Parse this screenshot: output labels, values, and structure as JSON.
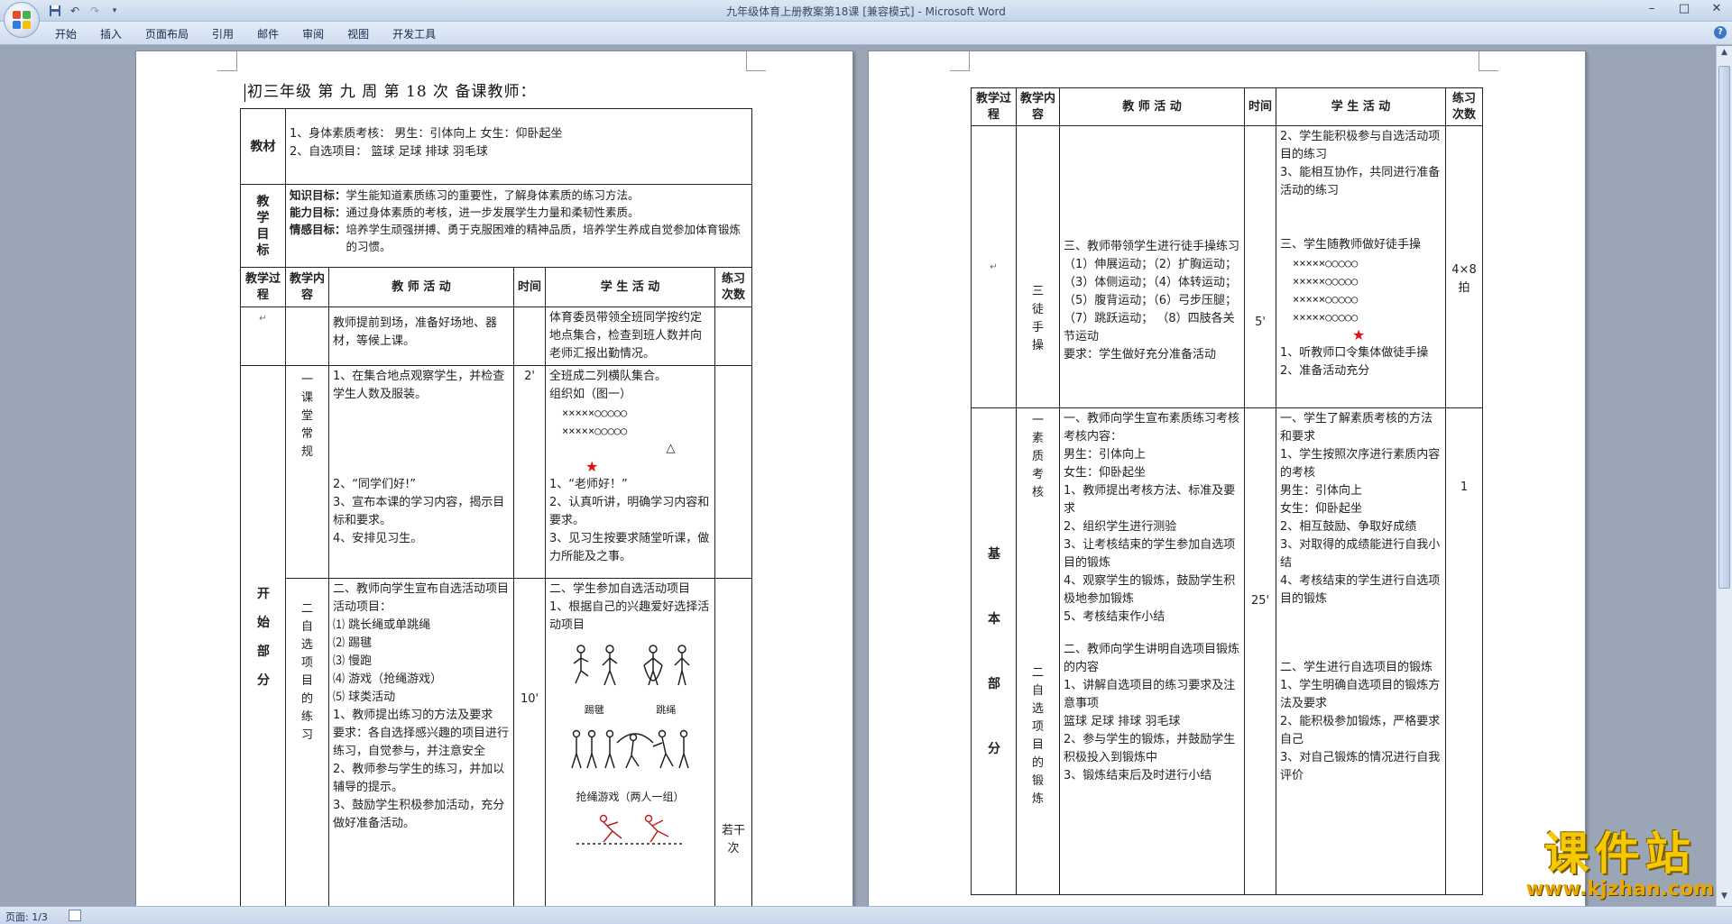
{
  "window": {
    "title": "九年级体育上册教案第18课 [兼容模式] - Microsoft Word"
  },
  "ribbon": {
    "tabs": [
      "开始",
      "插入",
      "页面布局",
      "引用",
      "邮件",
      "审阅",
      "视图",
      "开发工具"
    ]
  },
  "qat": {
    "undo": "↶",
    "redo": "↷"
  },
  "statusbar": {
    "page": "页面: 1/3"
  },
  "watermark": {
    "title": "课件站",
    "url": "www.kjzhan.com"
  },
  "page1": {
    "heading": "初三年级    第 九 周    第 18 次    备课教师：",
    "jiaocai_label": "教材",
    "jiaocai_l1": "1、身体素质考核：            男生：引体向上        女生：仰卧起坐",
    "jiaocai_l2": "2、自选项目：        篮球    足球    排球    羽毛球",
    "mubiao_label": "教学目标",
    "zhishi_label": "知识目标：",
    "zhishi": "学生能知道素质练习的重要性，了解身体素质的练习方法。",
    "nengli_label": "能力目标：",
    "nengli": "通过身体素质的考核，进一步发展学生力量和柔韧性素质。",
    "qinggan_label": "情感目标：",
    "qinggan": "培养学生顽强拼搏、勇于克服困难的精神品质，培养学生养成自觉参加体育锻炼的习惯。",
    "headers": [
      "教学过程",
      "教学内容",
      "教  师  活  动",
      "时间",
      "学  生  活  动",
      "练习次数"
    ],
    "r1_teacher": "教师提前到场，准备好场地、器材，等候上课。",
    "r1_student": "体育委员带领全班同学按约定地点集合，检查到班人数并向老师汇报出勤情况。",
    "part_label": "开始部分",
    "r2_content": "一课堂常规",
    "r2_teacher_1": "1、在集合地点观察学生，并检查学生人数及服装。",
    "r2_teacher_2": "2、“同学们好!”",
    "r2_teacher_3": "3、宣布本课的学习内容，揭示目标和要求。",
    "r2_teacher_4": "4、安排见习生。",
    "r2_time": "2'",
    "r2_student_1": "全班成二列横队集合。",
    "r2_student_2": "组织如（图一）",
    "formation_row": "×××××○○○○○",
    "triangle": "△",
    "star": "★",
    "r2_student_3": "1、“老师好！”",
    "r2_student_4": "2、认真听讲，明确学习内容和要求。",
    "r2_student_5": "3、见习生按要求随堂听课，做力所能及之事。",
    "r3_content": "二自选项目的练习",
    "r3_teacher_1": "二、教师向学生宣布自选活动项目",
    "r3_teacher_2": "活动项目：",
    "r3_teacher_3": "⑴ 跳长绳或单跳绳",
    "r3_teacher_4": "⑵ 踢毽",
    "r3_teacher_5": "⑶ 慢跑",
    "r3_teacher_6": "⑷ 游戏（抢绳游戏）",
    "r3_teacher_7": "⑸ 球类活动",
    "r3_teacher_8": "1、教师提出练习的方法及要求",
    "r3_teacher_9": "要求：各自选择感兴趣的项目进行练习，自觉参与，并注意安全",
    "r3_teacher_10": "2、教师参与学生的练习，并加以辅导的提示。",
    "r3_teacher_11": "3、鼓励学生积极参加活动，充分做好准备活动。",
    "r3_time": "10'",
    "r3_student_1": "二、学生参加自选活动项目",
    "r3_student_2": "1、根据自己的兴趣爱好选择活动项目",
    "r3_caption1a": "踢毽",
    "r3_caption1b": "跳绳",
    "r3_caption2": "抢绳游戏（两人一组）",
    "r3_times": "若干次"
  },
  "page2": {
    "headers": [
      "教学过程",
      "教学内容",
      "教  师  活  动",
      "时间",
      "学  生  活  动",
      "练习次数"
    ],
    "a_content": "三徒手操",
    "a_teacher_1": "三、教师带领学生进行徒手操练习",
    "a_teacher_2": "（1）伸展运动；（2）扩胸运动；",
    "a_teacher_3": "（3）体侧运动；（4）体转运动；",
    "a_teacher_4": "（5）腹背运动；（6）弓步压腿；",
    "a_teacher_5": "（7）跳跃运动；  （8）四肢各关节运动",
    "a_teacher_6": "要求：学生做好充分准备活动",
    "a_time": "5'",
    "a_student_1": "2、学生能积极参与自选活动项目的练习",
    "a_student_2": "3、能相互协作，共同进行准备活动的练习",
    "a_student_3": "三、学生随教师做好徒手操",
    "formation_row": "×××××○○○○○",
    "star": "★",
    "a_student_4": "1、听教师口令集体做徒手操",
    "a_student_5": "2、准备活动充分",
    "a_times": "4×8拍",
    "part_label": "基本部分",
    "b_content": "一素质考核",
    "b_teacher_1": "一、教师向学生宣布素质练习考核",
    "b_teacher_2": "考核内容：",
    "b_teacher_3": "男生：引体向上",
    "b_teacher_4": "女生：仰卧起坐",
    "b_teacher_5": "1、教师提出考核方法、标准及要求",
    "b_teacher_6": "2、组织学生进行测验",
    "b_teacher_7": "3、让考核结束的学生参加自选项目的锻炼",
    "b_teacher_8": "4、观察学生的锻炼，鼓励学生积极地参加锻炼",
    "b_teacher_9": "5、考核结束作小结",
    "b_time": "25'",
    "b_student_1": "一、学生了解素质考核的方法和要求",
    "b_student_2": "1、学生按照次序进行素质内容的考核",
    "b_student_3": "男生：引体向上",
    "b_student_4": "女生：仰卧起坐",
    "b_student_5": "2、相互鼓励、争取好成绩",
    "b_student_6": "3、对取得的成绩能进行自我小结",
    "b_student_7": "4、考核结束的学生进行自选项目的锻炼",
    "b_times": "1",
    "c_content": "二自选项目的锻炼",
    "c_teacher_1": "二、教师向学生讲明自选项目锻炼的内容",
    "c_teacher_2": "1、讲解自选项目的练习要求及注意事项",
    "c_teacher_3": "篮球  足球   排球    羽毛球",
    "c_teacher_4": "2、参与学生的锻炼，并鼓励学生积极投入到锻炼中",
    "c_teacher_5": "3、锻炼结束后及时进行小结",
    "c_student_1": "二、学生进行自选项目的锻炼",
    "c_student_2": "1、学生明确自选项目的锻炼方法及要求",
    "c_student_3": "2、能积极参加锻炼，严格要求自己",
    "c_student_4": "3、对自己锻炼的情况进行自我评价"
  }
}
